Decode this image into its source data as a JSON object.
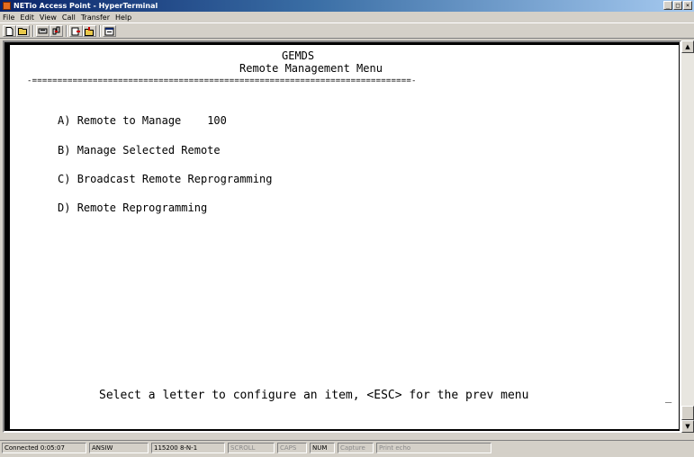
{
  "window": {
    "title": "NETio Access Point - HyperTerminal",
    "buttons": {
      "minimize": "_",
      "maximize": "□",
      "close": "×"
    }
  },
  "menu": [
    "File",
    "Edit",
    "View",
    "Call",
    "Transfer",
    "Help"
  ],
  "toolbar": [
    "new-icon",
    "open-icon",
    "disconnect-icon",
    "connect-icon",
    "send-icon",
    "receive-icon",
    "properties-icon"
  ],
  "terminal": {
    "header": "GEMDS",
    "title": "Remote Management Menu",
    "rule": "-===========================================================================-",
    "items": [
      {
        "key": "A)",
        "label": "Remote to Manage",
        "value": "100"
      },
      {
        "key": "B)",
        "label": "Manage Selected Remote",
        "value": ""
      },
      {
        "key": "C)",
        "label": "Broadcast Remote Reprogramming",
        "value": ""
      },
      {
        "key": "D)",
        "label": "Remote Reprogramming",
        "value": ""
      }
    ],
    "prompt": "Select a letter to configure an item, <ESC> for the prev menu",
    "cursor": "_"
  },
  "status": {
    "connected": "Connected 0:05:07",
    "emulation": "ANSIW",
    "settings": "115200 8-N-1",
    "scroll": "SCROLL",
    "caps": "CAPS",
    "num": "NUM",
    "capture": "Capture",
    "print_echo": "Print echo"
  }
}
